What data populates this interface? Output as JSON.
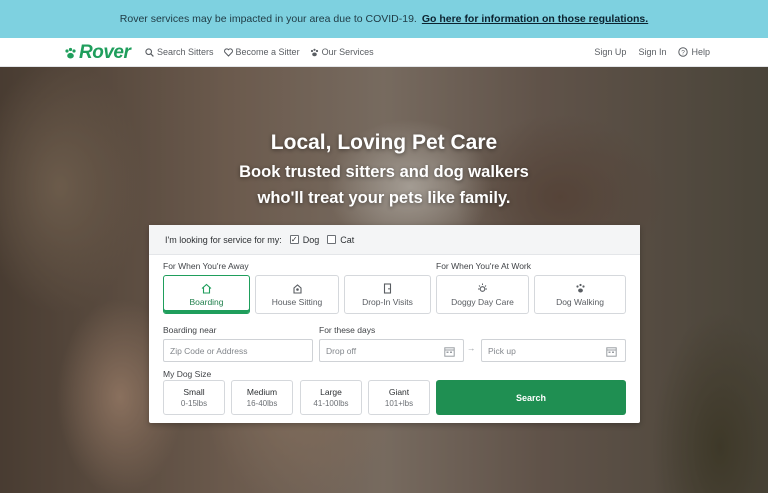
{
  "banner": {
    "text": "Rover services may be impacted in your area due to COVID-19.",
    "link": "Go here for information on those regulations."
  },
  "nav": {
    "logo": "Rover",
    "items": [
      {
        "label": "Search Sitters",
        "icon": "search-icon"
      },
      {
        "label": "Become a Sitter",
        "icon": "heart-icon"
      },
      {
        "label": "Our Services",
        "icon": "paw-icon"
      }
    ],
    "sign_up": "Sign Up",
    "sign_in": "Sign In",
    "help": "Help"
  },
  "hero": {
    "title": "Local, Loving Pet Care",
    "subtitle_line1": "Book trusted sitters and dog walkers",
    "subtitle_line2": "who'll treat your pets like family."
  },
  "search_form": {
    "looking_for_label": "I'm looking for service for my:",
    "pets": [
      {
        "label": "Dog",
        "checked": true
      },
      {
        "label": "Cat",
        "checked": false
      }
    ],
    "away_heading": "For When You're Away",
    "work_heading": "For When You're At Work",
    "services": [
      {
        "label": "Boarding",
        "active": true,
        "icon": "house-icon"
      },
      {
        "label": "House Sitting",
        "active": false,
        "icon": "sitter-icon"
      },
      {
        "label": "Drop-In Visits",
        "active": false,
        "icon": "door-icon"
      },
      {
        "label": "Doggy Day Care",
        "active": false,
        "icon": "sun-icon"
      },
      {
        "label": "Dog Walking",
        "active": false,
        "icon": "paw-icon"
      }
    ],
    "boarding_near_label": "Boarding near",
    "location_placeholder": "Zip Code or Address",
    "days_label": "For these days",
    "drop_off_placeholder": "Drop off",
    "pick_up_placeholder": "Pick up",
    "arrow": "→",
    "dog_size_label": "My Dog Size",
    "sizes": [
      {
        "label": "Small",
        "range": "0-15lbs"
      },
      {
        "label": "Medium",
        "range": "16-40lbs"
      },
      {
        "label": "Large",
        "range": "41-100lbs"
      },
      {
        "label": "Giant",
        "range": "101+lbs"
      }
    ],
    "search_button": "Search"
  },
  "colors": {
    "brand_green": "#1f9e5c",
    "banner_blue": "#7ed1e0",
    "search_button": "#1f8f52"
  }
}
